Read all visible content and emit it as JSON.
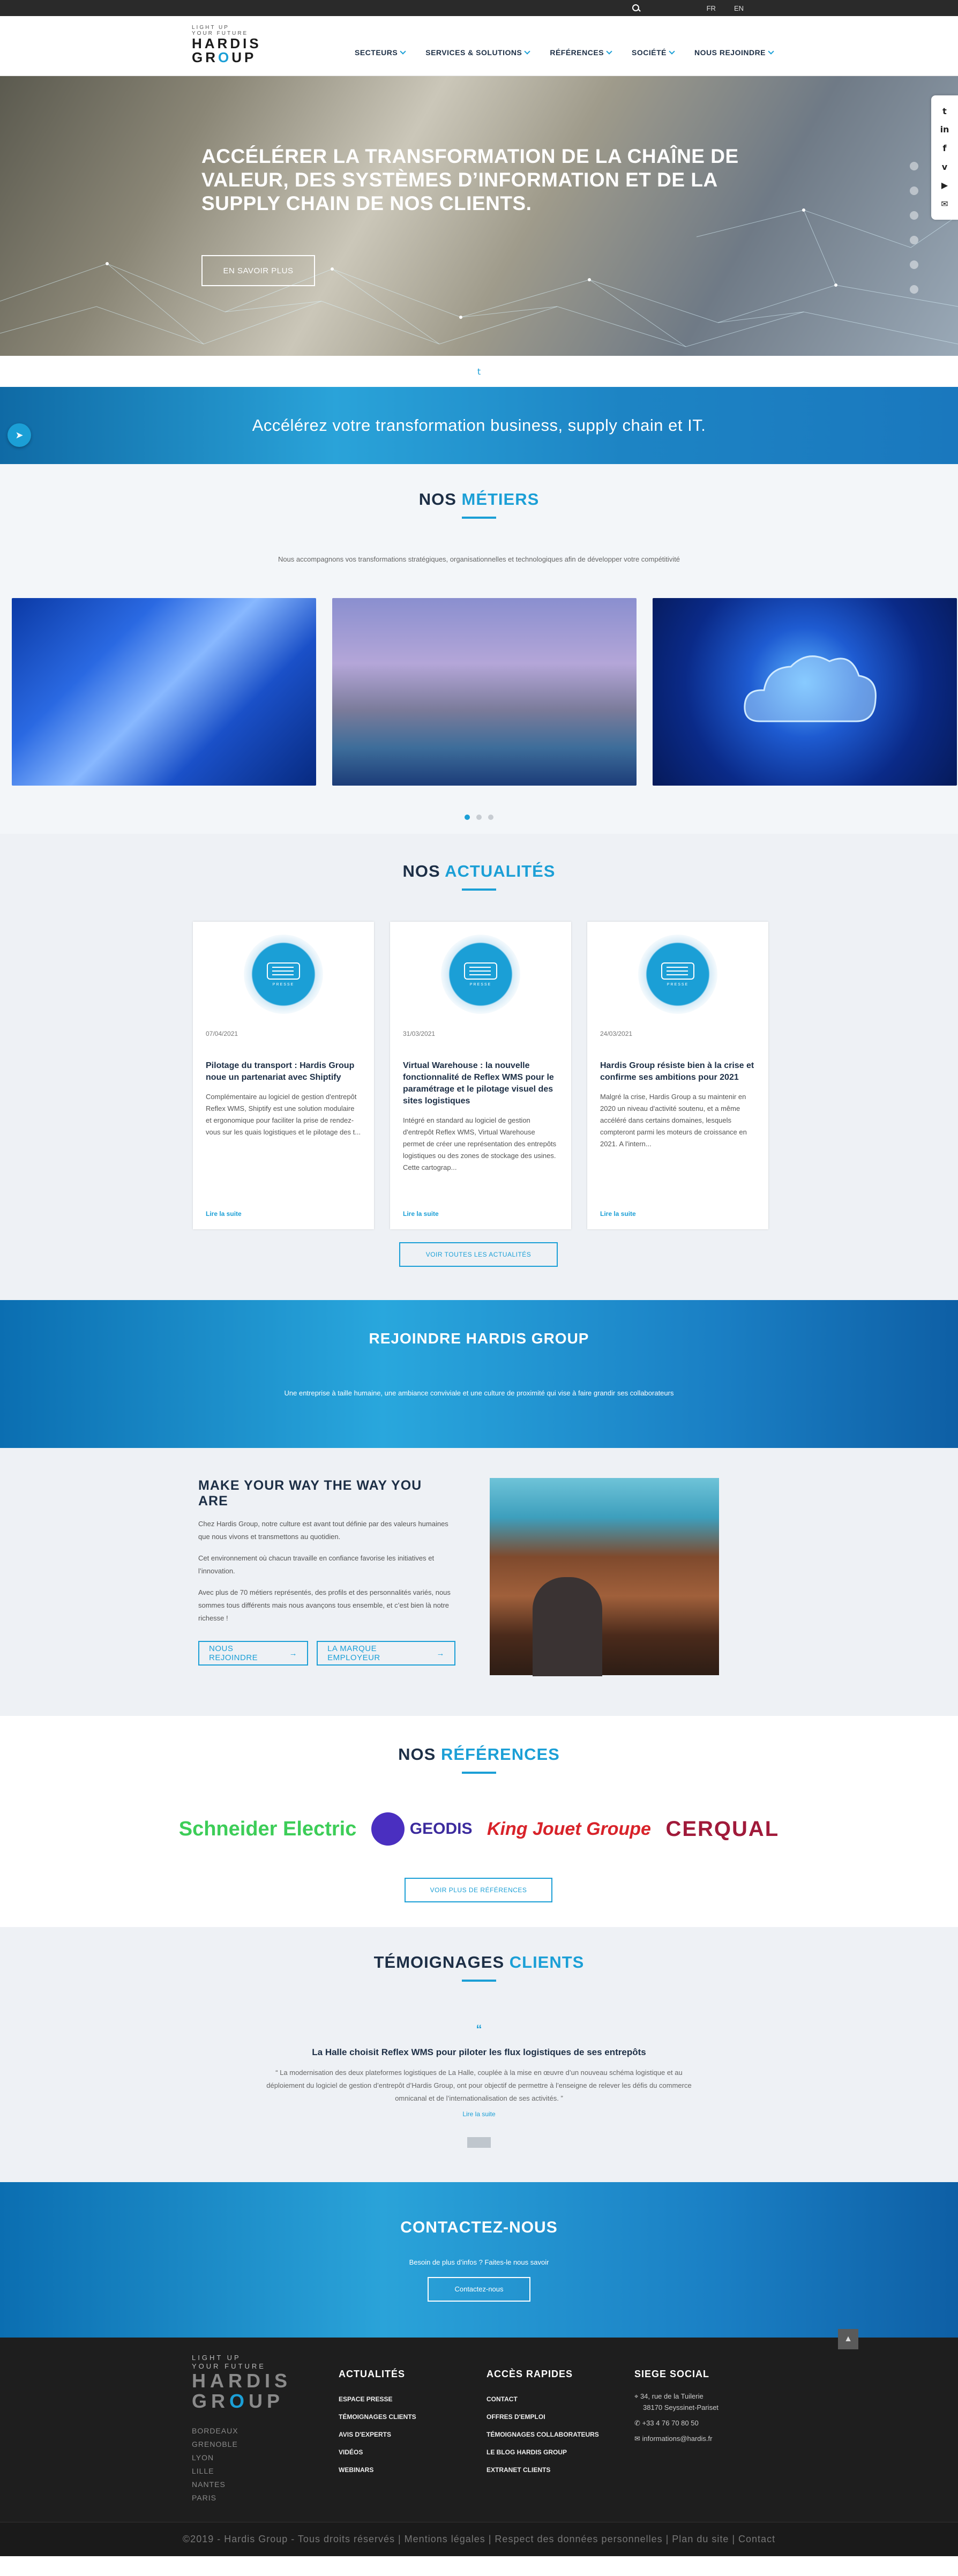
{
  "topbar": {
    "lang_fr": "FR",
    "lang_en": "EN"
  },
  "logo": {
    "tagline1": "LIGHT UP",
    "tagline2": "YOUR FUTURE",
    "name1": "HARDIS",
    "name2a": "GR",
    "name2o": "O",
    "name2b": "UP"
  },
  "nav": {
    "items": [
      "SECTEURS",
      "SERVICES & SOLUTIONS",
      "RÉFÉRENCES",
      "SOCIÉTÉ",
      "NOUS REJOINDRE"
    ]
  },
  "social": {
    "icons": [
      "twitter-icon",
      "linkedin-icon",
      "facebook-icon",
      "viadeo-icon",
      "youtube-icon",
      "email-icon"
    ]
  },
  "hero": {
    "title": "ACCÉLÉRER LA TRANSFORMATION DE LA CHAÎNE DE VALEUR, DES SYSTÈMES D’INFORMATION ET DE LA SUPPLY CHAIN DE NOS CLIENTS.",
    "button": "EN SAVOIR PLUS"
  },
  "banner": {
    "text": "Accélérez votre transformation business, supply chain et IT."
  },
  "metiers": {
    "title_a": "NOS ",
    "title_b": "MÉTIERS",
    "intro": "Nous accompagnons vos transformations stratégiques, organisationnelles et technologiques afin de développer votre compétitivité"
  },
  "actualites": {
    "title_a": "NOS ",
    "title_b": "ACTUALITÉS",
    "badge_label": "PRESSE",
    "items": [
      {
        "date": "07/04/2021",
        "title": "Pilotage du transport : Hardis Group noue un partenariat avec Shiptify",
        "text": "Complémentaire au logiciel de gestion d'entrepôt Reflex WMS, Shiptify est une solution modulaire et ergonomique pour faciliter la prise de rendez-vous sur les quais logistiques et le pilotage des t...",
        "more": "Lire la suite"
      },
      {
        "date": "31/03/2021",
        "title": "Virtual Warehouse : la nouvelle fonctionnalité de Reflex WMS pour le paramétrage et le pilotage visuel des sites logistiques",
        "text": "Intégré en standard au logiciel de gestion d'entrepôt Reflex WMS, Virtual Warehouse permet de créer une représentation des entrepôts logistiques ou des zones de stockage des usines. Cette cartograp...",
        "more": "Lire la suite"
      },
      {
        "date": "24/03/2021",
        "title": "Hardis Group résiste bien à la crise et confirme ses ambitions pour 2021",
        "text": "Malgré la crise, Hardis Group a su maintenir en 2020 un niveau d'activité soutenu, et a même accéléré dans certains domaines, lesquels compteront parmi les moteurs de croissance en 2021. A l'intern...",
        "more": "Lire la suite"
      }
    ],
    "button": "VOIR TOUTES LES ACTUALITÉS"
  },
  "rejoindre": {
    "title": "REJOINDRE HARDIS GROUP",
    "text": "Une entreprise à taille humaine, une ambiance conviviale et une culture de proximité qui vise à faire grandir ses collaborateurs"
  },
  "makeway": {
    "title": "MAKE YOUR WAY THE WAY YOU ARE",
    "p1": "Chez Hardis Group, notre culture est avant tout définie par des valeurs humaines que nous vivons et transmettons au quotidien.",
    "p2": "Cet environnement où chacun travaille en confiance favorise les initiatives et l’innovation.",
    "p3": "Avec plus de 70 métiers représentés, des profils et des personnalités variés, nous sommes tous différents mais nous avançons tous ensemble, et c’est bien là notre richesse !",
    "btn1": "NOUS REJOINDRE",
    "btn2": "LA MARQUE EMPLOYEUR"
  },
  "references": {
    "title_a": "NOS ",
    "title_b": "RÉFÉRENCES",
    "logos": [
      "Schneider Electric",
      "GEODIS",
      "King Jouet Groupe",
      "CERQUAL"
    ],
    "button": "VOIR PLUS DE RÉFÉRENCES"
  },
  "temoignages": {
    "title_a": "TÉMOIGNAGES ",
    "title_b": "CLIENTS",
    "quote_mark": "“",
    "heading": "La Halle choisit Reflex WMS pour piloter les flux logistiques de ses entrepôts",
    "text": "“ La modernisation des deux plateformes logistiques de La Halle, couplée à la mise en œuvre d’un nouveau schéma logistique et au déploiement du logiciel de gestion d’entrepôt d’Hardis Group, ont pour objectif de permettre à l’enseigne de relever les défis du commerce omnicanal et de l’internationalisation de ses activités. ”",
    "more": "Lire la suite"
  },
  "contact": {
    "title": "CONTACTEZ-NOUS",
    "text": "Besoin de plus d’infos ? Faites-le nous savoir",
    "button": "Contactez-nous"
  },
  "footer": {
    "tag1": "LIGHT UP",
    "tag2": "YOUR FUTURE",
    "name1": "HARDIS",
    "name2a": "GR",
    "name2o": "O",
    "name2b": "UP",
    "cities": [
      "BORDEAUX",
      "GRENOBLE",
      "LYON",
      "LILLE",
      "NANTES",
      "PARIS"
    ],
    "col1": {
      "title": "ACTUALITÉS",
      "links": [
        "ESPACE PRESSE",
        "TÉMOIGNAGES CLIENTS",
        "AVIS D'EXPERTS",
        "VIDÉOS",
        "WEBINARS"
      ]
    },
    "col2": {
      "title": "ACCÈS RAPIDES",
      "links": [
        "CONTACT",
        "OFFRES D'EMPLOI",
        "TÉMOIGNAGES COLLABORATEURS",
        "LE BLOG HARDIS GROUP",
        "EXTRANET CLIENTS"
      ]
    },
    "col3": {
      "title": "SIEGE SOCIAL",
      "address1": "34, rue de la Tuilerie",
      "address2": "38170 Seyssinet-Pariset",
      "phone": "+33 4 76 70 80 50",
      "email": "informations@hardis.fr"
    },
    "copyright": "©2019 - Hardis Group - Tous droits réservés  |  Mentions légales  |  Respect des données personnelles  |  Plan du site  |  Contact"
  }
}
